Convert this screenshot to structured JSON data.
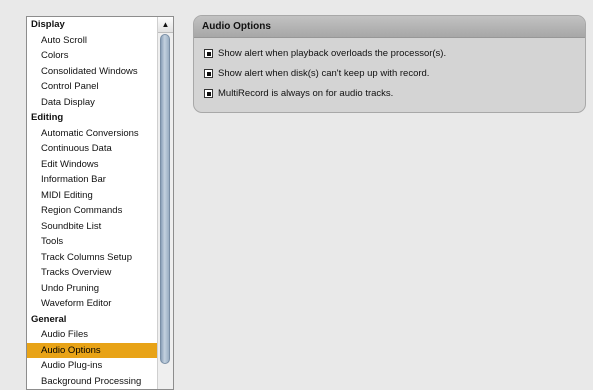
{
  "sidebar": {
    "sections": [
      {
        "label": "Display",
        "items": [
          "Auto Scroll",
          "Colors",
          "Consolidated Windows",
          "Control Panel",
          "Data Display"
        ]
      },
      {
        "label": "Editing",
        "items": [
          "Automatic Conversions",
          "Continuous Data",
          "Edit Windows",
          "Information Bar",
          "MIDI Editing",
          "Region Commands",
          "Soundbite List",
          "Tools",
          "Track Columns Setup",
          "Tracks Overview",
          "Undo Pruning",
          "Waveform Editor"
        ]
      },
      {
        "label": "General",
        "items": [
          "Audio Files",
          "Audio Options",
          "Audio Plug-ins",
          "Background Processing"
        ]
      }
    ],
    "selected": "Audio Options",
    "scroll_up_glyph": "▲"
  },
  "panel": {
    "title": "Audio Options",
    "options": [
      {
        "label": "Show alert when playback overloads the processor(s).",
        "checked": true
      },
      {
        "label": "Show alert when disk(s) can't keep up with record.",
        "checked": true
      },
      {
        "label": "MultiRecord is always on for audio tracks.",
        "checked": true
      }
    ]
  },
  "colors": {
    "selection": "#e8a317",
    "background": "#e9e9e9",
    "panel": "#d4d4d4",
    "scroll_thumb": "#a9bbcd"
  }
}
